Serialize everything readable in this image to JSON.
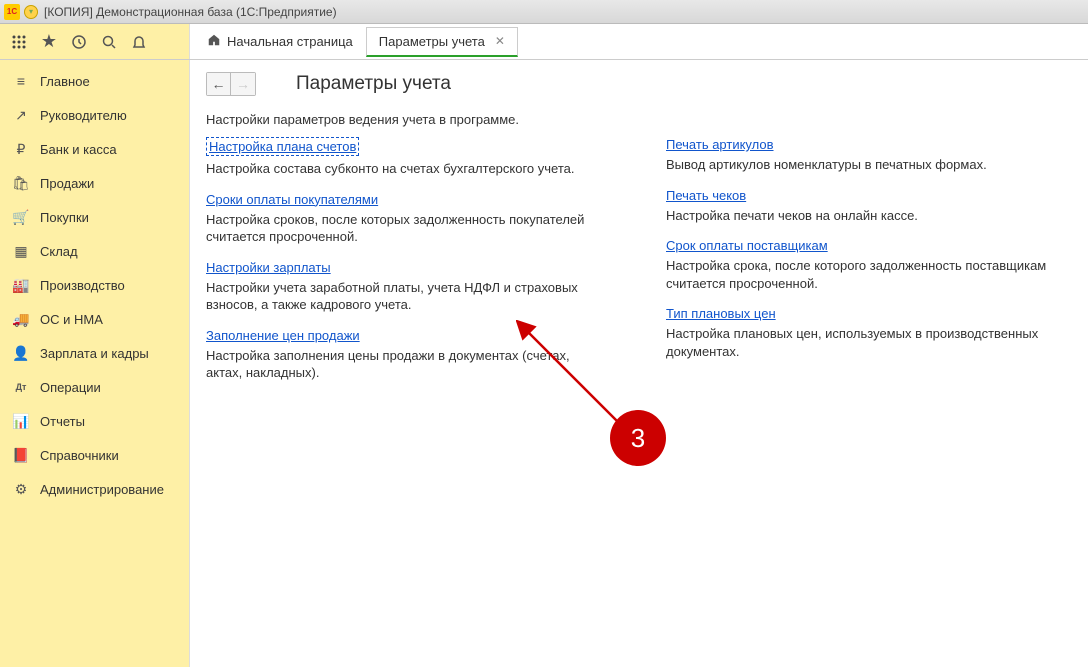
{
  "titlebar": {
    "title": "[КОПИЯ] Демонстрационная база  (1С:Предприятие)"
  },
  "tabs": {
    "home": "Начальная страница",
    "active": "Параметры учета"
  },
  "sidebar": [
    {
      "icon": "≡",
      "label": "Главное"
    },
    {
      "icon": "↗",
      "label": "Руководителю"
    },
    {
      "icon": "₽",
      "label": "Банк и касса"
    },
    {
      "icon": "🛍",
      "label": "Продажи"
    },
    {
      "icon": "🛒",
      "label": "Покупки"
    },
    {
      "icon": "▦",
      "label": "Склад"
    },
    {
      "icon": "🏭",
      "label": "Производство"
    },
    {
      "icon": "🚚",
      "label": "ОС и НМА"
    },
    {
      "icon": "👤",
      "label": "Зарплата и кадры"
    },
    {
      "icon": "Дт",
      "label": "Операции"
    },
    {
      "icon": "📊",
      "label": "Отчеты"
    },
    {
      "icon": "📕",
      "label": "Справочники"
    },
    {
      "icon": "⚙",
      "label": "Администрирование"
    }
  ],
  "content": {
    "title": "Параметры учета",
    "intro": "Настройки параметров ведения учета в программе.",
    "left": [
      {
        "link": "Настройка плана счетов",
        "desc": "Настройка состава субконто на счетах бухгалтерского учета.",
        "boxed": true
      },
      {
        "link": "Сроки оплаты покупателями",
        "desc": "Настройка сроков, после которых задолженность покупателей считается просроченной."
      },
      {
        "link": "Настройки зарплаты",
        "desc": "Настройки учета заработной платы, учета НДФЛ и страховых взносов, а также кадрового учета."
      },
      {
        "link": "Заполнение цен продажи",
        "desc": "Настройка заполнения цены продажи в документах (счетах, актах, накладных)."
      }
    ],
    "right": [
      {
        "link": "Печать артикулов",
        "desc": "Вывод артикулов номенклатуры в печатных формах."
      },
      {
        "link": "Печать чеков",
        "desc": "Настройка печати чеков на онлайн кассе."
      },
      {
        "link": "Срок оплаты поставщикам",
        "desc": "Настройка срока, после которого задолженность поставщикам считается просроченной."
      },
      {
        "link": "Тип плановых цен",
        "desc": "Настройка плановых цен, используемых в производственных документах."
      }
    ]
  },
  "annotation": {
    "number": "3"
  }
}
